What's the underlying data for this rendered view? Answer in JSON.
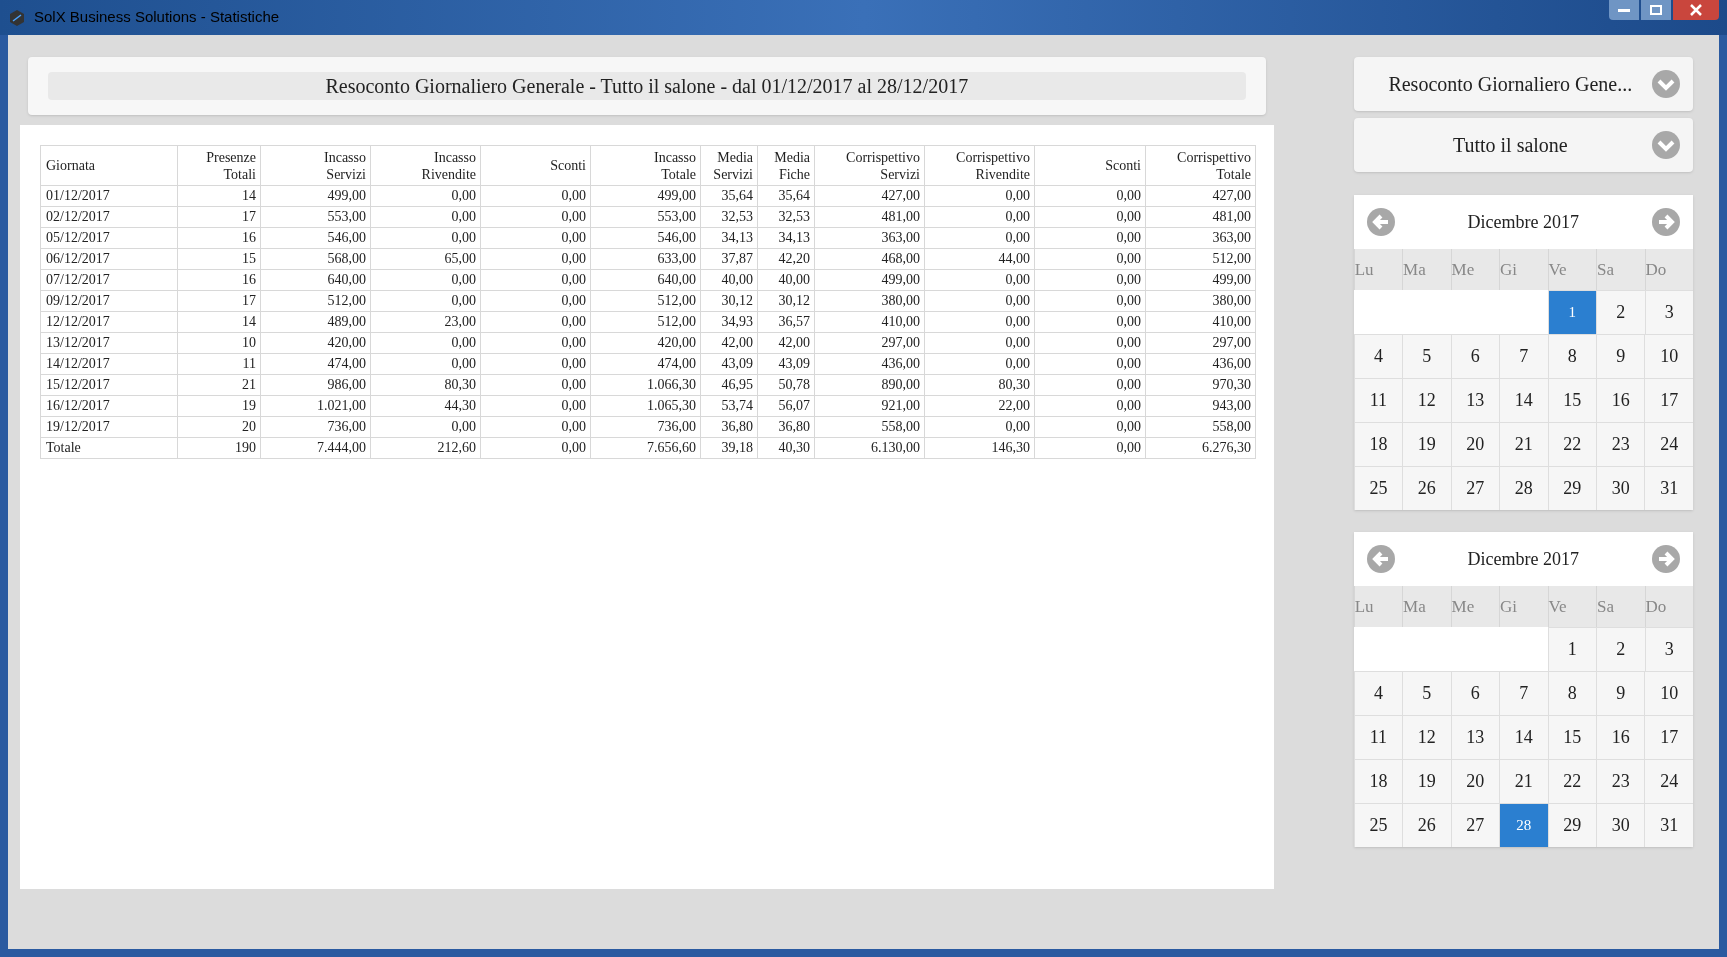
{
  "window": {
    "title": "SolX Business Solutions - Statistiche"
  },
  "report_title": "Resoconto Giornaliero Generale - Tutto il salone - dal 01/12/2017 al 28/12/2017",
  "table": {
    "columns": [
      "Giornata",
      "Presenze Totali",
      "Incasso Servizi",
      "Incasso Rivendite",
      "Sconti",
      "Incasso Totale",
      "Media Servizi",
      "Media Fiche",
      "Corrispettivo Servizi",
      "Corrispettivo Rivendite",
      "Sconti",
      "Corrispettivo Totale"
    ],
    "rows": [
      [
        "01/12/2017",
        "14",
        "499,00",
        "0,00",
        "0,00",
        "499,00",
        "35,64",
        "35,64",
        "427,00",
        "0,00",
        "0,00",
        "427,00"
      ],
      [
        "02/12/2017",
        "17",
        "553,00",
        "0,00",
        "0,00",
        "553,00",
        "32,53",
        "32,53",
        "481,00",
        "0,00",
        "0,00",
        "481,00"
      ],
      [
        "05/12/2017",
        "16",
        "546,00",
        "0,00",
        "0,00",
        "546,00",
        "34,13",
        "34,13",
        "363,00",
        "0,00",
        "0,00",
        "363,00"
      ],
      [
        "06/12/2017",
        "15",
        "568,00",
        "65,00",
        "0,00",
        "633,00",
        "37,87",
        "42,20",
        "468,00",
        "44,00",
        "0,00",
        "512,00"
      ],
      [
        "07/12/2017",
        "16",
        "640,00",
        "0,00",
        "0,00",
        "640,00",
        "40,00",
        "40,00",
        "499,00",
        "0,00",
        "0,00",
        "499,00"
      ],
      [
        "09/12/2017",
        "17",
        "512,00",
        "0,00",
        "0,00",
        "512,00",
        "30,12",
        "30,12",
        "380,00",
        "0,00",
        "0,00",
        "380,00"
      ],
      [
        "12/12/2017",
        "14",
        "489,00",
        "23,00",
        "0,00",
        "512,00",
        "34,93",
        "36,57",
        "410,00",
        "0,00",
        "0,00",
        "410,00"
      ],
      [
        "13/12/2017",
        "10",
        "420,00",
        "0,00",
        "0,00",
        "420,00",
        "42,00",
        "42,00",
        "297,00",
        "0,00",
        "0,00",
        "297,00"
      ],
      [
        "14/12/2017",
        "11",
        "474,00",
        "0,00",
        "0,00",
        "474,00",
        "43,09",
        "43,09",
        "436,00",
        "0,00",
        "0,00",
        "436,00"
      ],
      [
        "15/12/2017",
        "21",
        "986,00",
        "80,30",
        "0,00",
        "1.066,30",
        "46,95",
        "50,78",
        "890,00",
        "80,30",
        "0,00",
        "970,30"
      ],
      [
        "16/12/2017",
        "19",
        "1.021,00",
        "44,30",
        "0,00",
        "1.065,30",
        "53,74",
        "56,07",
        "921,00",
        "22,00",
        "0,00",
        "943,00"
      ],
      [
        "19/12/2017",
        "20",
        "736,00",
        "0,00",
        "0,00",
        "736,00",
        "36,80",
        "36,80",
        "558,00",
        "0,00",
        "0,00",
        "558,00"
      ],
      [
        "Totale",
        "190",
        "7.444,00",
        "212,60",
        "0,00",
        "7.656,60",
        "39,18",
        "40,30",
        "6.130,00",
        "146,30",
        "0,00",
        "6.276,30"
      ]
    ]
  },
  "dropdowns": [
    "Resoconto Giornaliero Gene...",
    "Tutto il salone"
  ],
  "calendars": [
    {
      "month": "Dicembre 2017",
      "weekdays": [
        "Lu",
        "Ma",
        "Me",
        "Gi",
        "Ve",
        "Sa",
        "Do"
      ],
      "weeks": [
        [
          {
            "label": "1",
            "selected": true
          },
          {
            "label": "2",
            "selected": false
          },
          {
            "label": "3",
            "selected": false
          }
        ],
        [
          {
            "label": "4",
            "selected": false
          },
          {
            "label": "5",
            "selected": false
          },
          {
            "label": "6",
            "selected": false
          },
          {
            "label": "7",
            "selected": false
          },
          {
            "label": "8",
            "selected": false
          },
          {
            "label": "9",
            "selected": false
          },
          {
            "label": "10",
            "selected": false
          }
        ],
        [
          {
            "label": "11",
            "selected": false
          },
          {
            "label": "12",
            "selected": false
          },
          {
            "label": "13",
            "selected": false
          },
          {
            "label": "14",
            "selected": false
          },
          {
            "label": "15",
            "selected": false
          },
          {
            "label": "16",
            "selected": false
          },
          {
            "label": "17",
            "selected": false
          }
        ],
        [
          {
            "label": "18",
            "selected": false
          },
          {
            "label": "19",
            "selected": false
          },
          {
            "label": "20",
            "selected": false
          },
          {
            "label": "21",
            "selected": false
          },
          {
            "label": "22",
            "selected": false
          },
          {
            "label": "23",
            "selected": false
          },
          {
            "label": "24",
            "selected": false
          }
        ],
        [
          {
            "label": "25",
            "selected": false
          },
          {
            "label": "26",
            "selected": false
          },
          {
            "label": "27",
            "selected": false
          },
          {
            "label": "28",
            "selected": false
          },
          {
            "label": "29",
            "selected": false
          },
          {
            "label": "30",
            "selected": false
          },
          {
            "label": "31",
            "selected": false
          }
        ]
      ]
    },
    {
      "month": "Dicembre 2017",
      "weekdays": [
        "Lu",
        "Ma",
        "Me",
        "Gi",
        "Ve",
        "Sa",
        "Do"
      ],
      "weeks": [
        [
          {
            "label": "1",
            "selected": false
          },
          {
            "label": "2",
            "selected": false
          },
          {
            "label": "3",
            "selected": false
          }
        ],
        [
          {
            "label": "4",
            "selected": false
          },
          {
            "label": "5",
            "selected": false
          },
          {
            "label": "6",
            "selected": false
          },
          {
            "label": "7",
            "selected": false
          },
          {
            "label": "8",
            "selected": false
          },
          {
            "label": "9",
            "selected": false
          },
          {
            "label": "10",
            "selected": false
          }
        ],
        [
          {
            "label": "11",
            "selected": false
          },
          {
            "label": "12",
            "selected": false
          },
          {
            "label": "13",
            "selected": false
          },
          {
            "label": "14",
            "selected": false
          },
          {
            "label": "15",
            "selected": false
          },
          {
            "label": "16",
            "selected": false
          },
          {
            "label": "17",
            "selected": false
          }
        ],
        [
          {
            "label": "18",
            "selected": false
          },
          {
            "label": "19",
            "selected": false
          },
          {
            "label": "20",
            "selected": false
          },
          {
            "label": "21",
            "selected": false
          },
          {
            "label": "22",
            "selected": false
          },
          {
            "label": "23",
            "selected": false
          },
          {
            "label": "24",
            "selected": false
          }
        ],
        [
          {
            "label": "25",
            "selected": false
          },
          {
            "label": "26",
            "selected": false
          },
          {
            "label": "27",
            "selected": false
          },
          {
            "label": "28",
            "selected": true
          },
          {
            "label": "29",
            "selected": false
          },
          {
            "label": "30",
            "selected": false
          },
          {
            "label": "31",
            "selected": false
          }
        ]
      ]
    }
  ]
}
